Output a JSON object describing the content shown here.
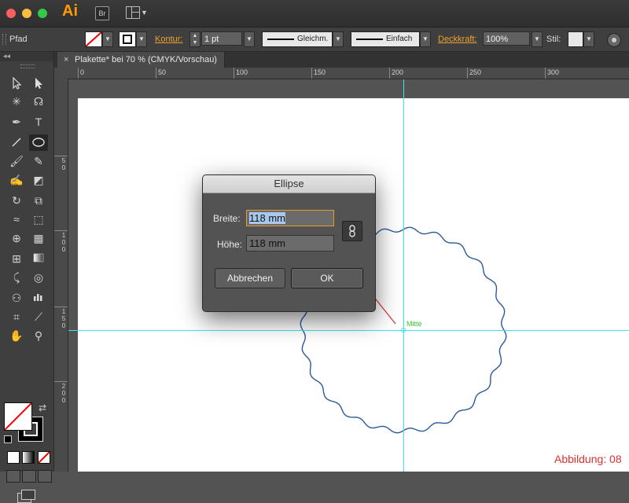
{
  "app": {
    "logo": "Ai",
    "bridge_label": "Br"
  },
  "control_bar": {
    "object_type": "Pfad",
    "kontur_label": "Kontur:",
    "stroke_weight": "1 pt",
    "profile_label": "Gleichm.",
    "brush_label": "Einfach",
    "deckkraft_label": "Deckkraft:",
    "opacity": "100%",
    "stil_label": "Stil:"
  },
  "document": {
    "tab_title": "Plakette* bei 70 % (CMYK/Vorschau)",
    "close_glyph": "×"
  },
  "ruler_h": [
    "0",
    "50",
    "100",
    "150",
    "200",
    "250",
    "300"
  ],
  "ruler_v": [
    "5\n0",
    "1\n0\n0",
    "1\n5\n0",
    "2\n0\n0"
  ],
  "canvas": {
    "center_label": "Mitte",
    "figure_label": "Abbildung: 08"
  },
  "dialog": {
    "title": "Ellipse",
    "width_label": "Breite:",
    "width_value": "118 mm",
    "height_label": "Höhe:",
    "height_value": "118 mm",
    "cancel_label": "Abbrechen",
    "ok_label": "OK"
  },
  "colors": {
    "guide": "#3fe3f0",
    "accent": "#f0a030",
    "annotation": "#e03030",
    "center_text": "#33cc33"
  },
  "tools": [
    "selection-tool",
    "direct-selection-tool",
    "magic-wand-tool",
    "lasso-tool",
    "pen-tool",
    "type-tool",
    "line-tool",
    "ellipse-tool",
    "paintbrush-tool",
    "pencil-tool",
    "blob-brush-tool",
    "eraser-tool",
    "rotate-tool",
    "scale-tool",
    "width-tool",
    "free-transform-tool",
    "shape-builder-tool",
    "perspective-grid-tool",
    "mesh-tool",
    "gradient-tool",
    "eyedropper-tool",
    "blend-tool",
    "symbol-sprayer-tool",
    "column-graph-tool",
    "artboard-tool",
    "slice-tool",
    "hand-tool",
    "zoom-tool"
  ]
}
